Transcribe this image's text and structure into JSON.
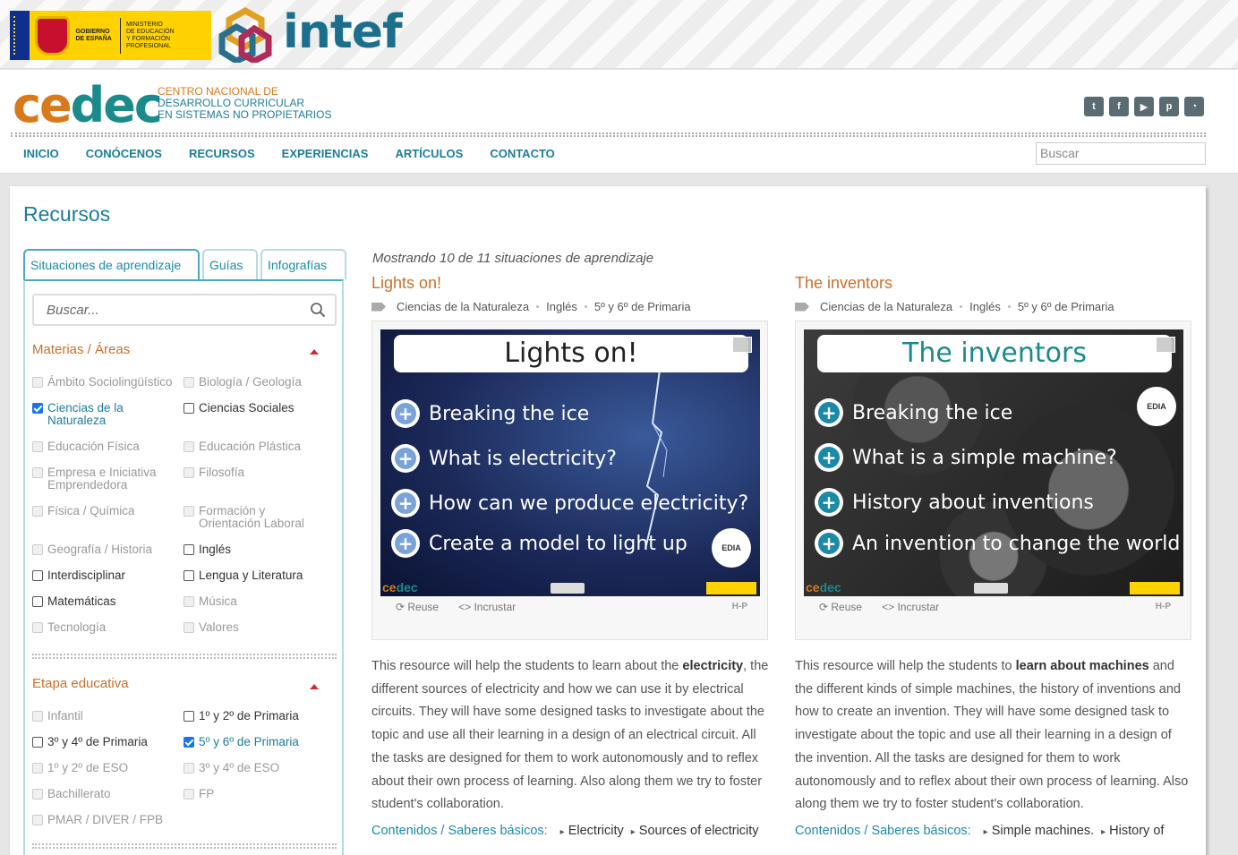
{
  "gov": {
    "line1": "GOBIERNO",
    "line2": "DE ESPAÑA",
    "m1": "MINISTERIO",
    "m2": "DE EDUCACIÓN",
    "m3": "Y FORMACIÓN PROFESIONAL",
    "intef": "intef"
  },
  "header": {
    "logo_ce": "ce",
    "logo_dec": "dec",
    "sub1": "Centro Nacional de",
    "sub2": "Desarrollo Curricular",
    "sub3": "en Sistemas no Propietarios",
    "social": [
      "twitter-icon",
      "facebook-icon",
      "youtube-icon",
      "pinterest-icon",
      "rss-icon"
    ],
    "nav": [
      "INICIO",
      "CONÓCENOS",
      "RECURSOS",
      "EXPERIENCIAS",
      "ARTÍCULOS",
      "CONTACTO"
    ],
    "search_placeholder": "Buscar"
  },
  "page": {
    "title": "Recursos",
    "tabs": [
      "Situaciones de aprendizaje",
      "Guías",
      "Infografías"
    ],
    "side_search_placeholder": "Buscar..."
  },
  "filters": {
    "materias_title": "Materias / Áreas",
    "materias": [
      {
        "label": "Ámbito Sociolingüístico",
        "state": "disabled"
      },
      {
        "label": "Biología / Geología",
        "state": "disabled"
      },
      {
        "label": "Ciencias de la Naturaleza",
        "state": "checked"
      },
      {
        "label": "Ciencias Sociales",
        "state": "enabled"
      },
      {
        "label": "Educación Física",
        "state": "disabled"
      },
      {
        "label": "Educación Plástica",
        "state": "disabled"
      },
      {
        "label": "Empresa e Iniciativa Emprendedora",
        "state": "disabled"
      },
      {
        "label": "Filosofía",
        "state": "disabled"
      },
      {
        "label": "Física / Química",
        "state": "disabled"
      },
      {
        "label": "Formación y Orientación Laboral",
        "state": "disabled"
      },
      {
        "label": "Geografía / Historia",
        "state": "disabled"
      },
      {
        "label": "Inglés",
        "state": "enabled"
      },
      {
        "label": "Interdisciplinar",
        "state": "enabled"
      },
      {
        "label": "Lengua y Literatura",
        "state": "enabled"
      },
      {
        "label": "Matemáticas",
        "state": "enabled"
      },
      {
        "label": "Música",
        "state": "disabled"
      },
      {
        "label": "Tecnología",
        "state": "disabled"
      },
      {
        "label": "Valores",
        "state": "disabled"
      }
    ],
    "etapa_title": "Etapa educativa",
    "etapas": [
      {
        "label": "Infantil",
        "state": "disabled"
      },
      {
        "label": "1º y 2º de Primaria",
        "state": "enabled"
      },
      {
        "label": "3º y 4º de Primaria",
        "state": "enabled"
      },
      {
        "label": "5º y 6º de Primaria",
        "state": "checked"
      },
      {
        "label": "1º y 2º de ESO",
        "state": "disabled"
      },
      {
        "label": "3º y 4º de ESO",
        "state": "disabled"
      },
      {
        "label": "Bachillerato",
        "state": "disabled"
      },
      {
        "label": "FP",
        "state": "disabled"
      },
      {
        "label": "PMAR / DIVER / FPB",
        "state": "disabled"
      }
    ]
  },
  "results": {
    "showing": "Mostrando 10 de 11 situaciones de aprendizaje",
    "items": [
      {
        "title": "Lights on!",
        "subject": "Ciencias de la Naturaleza",
        "language": "Inglés",
        "level": "5º y 6º de Primaria",
        "slide_title": "Lights on!",
        "bullets": [
          "Breaking the ice",
          "What is electricity?",
          "How can we produce electricity?",
          "Create a model to light up"
        ],
        "reuse": "Reuse",
        "embed": "Incrustar",
        "h5p": "H-P",
        "desc_a": "This resource will help the students to learn about the ",
        "desc_b": "electricity",
        "desc_c": ", the different sources of electricity and how we can use it by electrical circuits. They will have some designed tasks to investigate about the topic and use all their learning in a design of an electrical circuit.  All the tasks are designed for them to work autonomously and to reflex about their own process of learning. Also along them we try to foster student's collaboration.",
        "contents_label": "Contenidos / Saberes básicos:",
        "contents": [
          "Electricity",
          "Sources of electricity"
        ]
      },
      {
        "title": "The inventors",
        "subject": "Ciencias de la Naturaleza",
        "language": "Inglés",
        "level": "5º y 6º de Primaria",
        "slide_title": "The inventors",
        "bullets": [
          "Breaking the ice",
          "What is a simple machine?",
          "History about inventions",
          "An invention to change the world"
        ],
        "reuse": "Reuse",
        "embed": "Incrustar",
        "h5p": "H-P",
        "desc_a": "This resource will help the students to ",
        "desc_b": "learn about machines",
        "desc_c": " and the different kinds of simple machines, the history of inventions and how to create an invention. They will have some designed task to investigate about the topic and use all their learning in a design of the invention. All the tasks are designed for them to work autonomously and to reflex about their own process of learning. Also along them we try to foster student's collaboration.",
        "contents_label": "Contenidos / Saberes básicos:",
        "contents": [
          "Simple machines.",
          "History of"
        ]
      }
    ],
    "edia": "EDIA",
    "cedec_small": "cedec"
  }
}
